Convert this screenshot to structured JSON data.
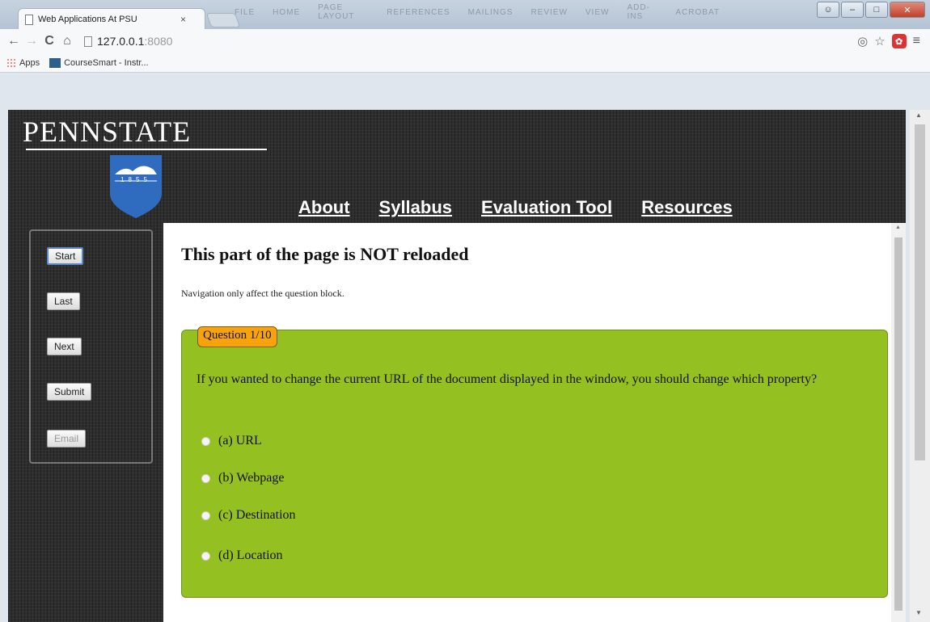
{
  "browser": {
    "tab_title": "Web Applications At PSU",
    "tab_close": "×",
    "url_host": "127.0.0.1",
    "url_port": ":8080",
    "back": "←",
    "forward": "→",
    "reload": "C",
    "home": "⌂",
    "bookmarks": [
      {
        "label": "Apps"
      },
      {
        "label": "CourseSmart - Instr..."
      }
    ],
    "ribbon_words": [
      "FILE",
      "HOME",
      "PAGE LAYOUT",
      "REFERENCES",
      "MAILINGS",
      "REVIEW",
      "VIEW",
      "ADD-INS",
      "ACROBAT"
    ]
  },
  "site": {
    "logo_text": "PENNSTATE",
    "shield_year": "1855",
    "nav": [
      {
        "label": "About"
      },
      {
        "label": "Syllabus"
      },
      {
        "label": "Evaluation Tool"
      },
      {
        "label": "Resources"
      }
    ],
    "buttons": [
      {
        "label": "Start",
        "state": "active"
      },
      {
        "label": "Last",
        "state": "normal"
      },
      {
        "label": "Next",
        "state": "normal"
      },
      {
        "label": "Submit",
        "state": "normal"
      },
      {
        "label": "Email",
        "state": "disabled"
      }
    ]
  },
  "main": {
    "title": "This part of the page is NOT reloaded",
    "subtitle": "Navigation only affect the question block.",
    "question_label": "Question 1/10",
    "question_text": "If you wanted to change the current URL of the document displayed in the window, you should change which property?",
    "options": [
      {
        "label": "(a) URL"
      },
      {
        "label": "(b) Webpage"
      },
      {
        "label": "(c) Destination"
      },
      {
        "label": "(d) Location"
      }
    ]
  },
  "colors": {
    "question_box": "#94c021",
    "question_label_bg": "#f8a30a",
    "header_bg": "#2e2e2e",
    "shield": "#2f6bbf"
  }
}
